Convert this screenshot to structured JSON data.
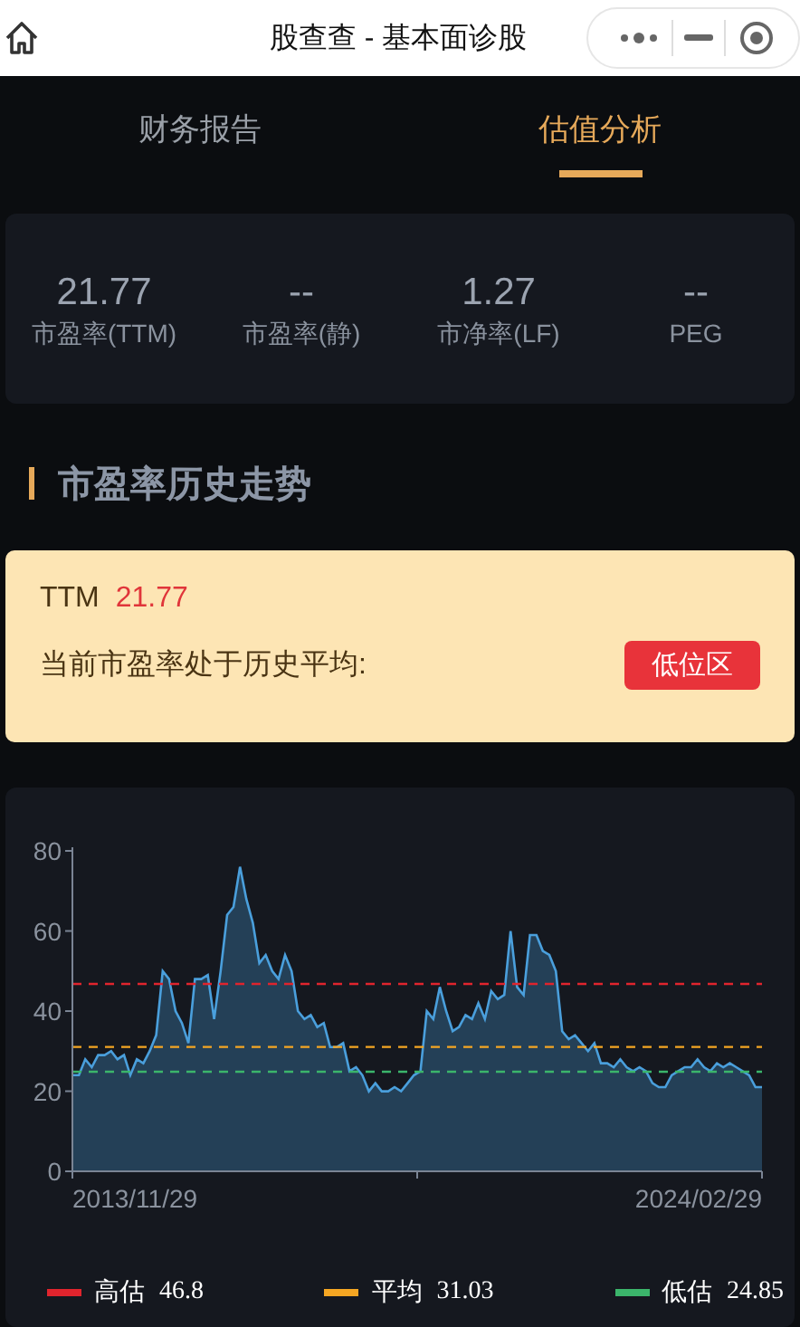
{
  "title_bar": {
    "title": "股查查 - 基本面诊股"
  },
  "tabs": [
    {
      "label": "财务报告",
      "selected": false
    },
    {
      "label": "估值分析",
      "selected": true
    }
  ],
  "metrics": [
    {
      "value": "21.77",
      "label": "市盈率(TTM)"
    },
    {
      "value": "--",
      "label": "市盈率(静)"
    },
    {
      "value": "1.27",
      "label": "市净率(LF)"
    },
    {
      "value": "--",
      "label": "PEG"
    }
  ],
  "section_title": "市盈率历史走势",
  "summary": {
    "label": "TTM",
    "value": "21.77",
    "text": "当前市盈率处于历史平均:",
    "badge": "低位区"
  },
  "chart": {
    "chart_data": {
      "type": "area",
      "ylim": [
        0,
        80
      ],
      "yticks": [
        0,
        20,
        40,
        60,
        80
      ],
      "legend": "bottom",
      "series": [
        {
          "color": "#4a9fdc",
          "values": [
            24,
            24,
            28,
            26,
            29,
            29,
            30,
            28,
            29,
            24,
            28,
            27,
            30,
            34,
            50,
            48,
            40,
            37,
            32,
            48,
            48,
            49,
            38,
            50,
            64,
            66,
            76,
            68,
            62,
            52,
            54,
            50,
            48,
            54,
            50,
            40,
            38,
            39,
            36,
            37,
            31,
            31,
            32,
            25,
            26,
            24,
            20,
            22,
            20,
            20,
            21,
            20,
            22,
            24,
            25,
            40,
            38,
            46,
            40,
            35,
            36,
            39,
            38,
            42,
            38,
            45,
            43,
            44,
            60,
            46,
            44,
            59,
            59,
            55,
            54,
            50,
            35,
            33,
            34,
            32,
            30,
            32,
            27,
            27,
            26,
            28,
            26,
            25,
            26,
            25,
            22,
            21,
            21,
            24,
            25,
            26,
            26,
            28,
            26,
            25,
            27,
            26,
            27,
            26,
            25,
            24,
            21,
            21
          ]
        },
        {
          "name": "高估",
          "type": "line",
          "line_style": "dashed",
          "color": "#e0242d",
          "values": [
            46.8,
            46.8,
            46.8,
            46.8,
            46.8,
            46.8,
            46.8,
            46.8,
            46.8,
            46.8,
            46.8,
            46.8,
            46.8,
            46.8,
            46.8,
            46.8,
            46.8,
            46.8,
            46.8,
            46.8,
            46.8,
            46.8,
            46.8,
            46.8,
            46.8,
            46.8,
            46.8,
            46.8,
            46.8,
            46.8,
            46.8,
            46.8,
            46.8,
            46.8,
            46.8,
            46.8,
            46.8,
            46.8,
            46.8,
            46.8,
            46.8,
            46.8,
            46.8,
            46.8,
            46.8,
            46.8,
            46.8,
            46.8,
            46.8,
            46.8,
            46.8,
            46.8,
            46.8,
            46.8,
            46.8,
            46.8,
            46.8,
            46.8,
            46.8,
            46.8,
            46.8,
            46.8,
            46.8,
            46.8,
            46.8,
            46.8,
            46.8,
            46.8,
            46.8,
            46.8,
            46.8,
            46.8,
            46.8,
            46.8,
            46.8,
            46.8,
            46.8,
            46.8,
            46.8,
            46.8,
            46.8,
            46.8,
            46.8,
            46.8,
            46.8,
            46.8,
            46.8,
            46.8,
            46.8,
            46.8,
            46.8,
            46.8,
            46.8,
            46.8,
            46.8,
            46.8,
            46.8,
            46.8,
            46.8,
            46.8,
            46.8,
            46.8,
            46.8,
            46.8,
            46.8,
            46.8,
            46.8,
            46.8
          ]
        },
        {
          "name": "平均",
          "type": "line",
          "line_style": "dashed",
          "color": "#f5a623",
          "values": [
            31.03,
            31.03,
            31.03,
            31.03,
            31.03,
            31.03,
            31.03,
            31.03,
            31.03,
            31.03,
            31.03,
            31.03,
            31.03,
            31.03,
            31.03,
            31.03,
            31.03,
            31.03,
            31.03,
            31.03,
            31.03,
            31.03,
            31.03,
            31.03,
            31.03,
            31.03,
            31.03,
            31.03,
            31.03,
            31.03,
            31.03,
            31.03,
            31.03,
            31.03,
            31.03,
            31.03,
            31.03,
            31.03,
            31.03,
            31.03,
            31.03,
            31.03,
            31.03,
            31.03,
            31.03,
            31.03,
            31.03,
            31.03,
            31.03,
            31.03,
            31.03,
            31.03,
            31.03,
            31.03,
            31.03,
            31.03,
            31.03,
            31.03,
            31.03,
            31.03,
            31.03,
            31.03,
            31.03,
            31.03,
            31.03,
            31.03,
            31.03,
            31.03,
            31.03,
            31.03,
            31.03,
            31.03,
            31.03,
            31.03,
            31.03,
            31.03,
            31.03,
            31.03,
            31.03,
            31.03,
            31.03,
            31.03,
            31.03,
            31.03,
            31.03,
            31.03,
            31.03,
            31.03,
            31.03,
            31.03,
            31.03,
            31.03,
            31.03,
            31.03,
            31.03,
            31.03,
            31.03,
            31.03,
            31.03,
            31.03,
            31.03,
            31.03,
            31.03,
            31.03,
            31.03,
            31.03,
            31.03,
            31.03
          ]
        },
        {
          "name": "低估",
          "type": "line",
          "line_style": "dashed",
          "color": "#3bb56b",
          "values": [
            24.85,
            24.85,
            24.85,
            24.85,
            24.85,
            24.85,
            24.85,
            24.85,
            24.85,
            24.85,
            24.85,
            24.85,
            24.85,
            24.85,
            24.85,
            24.85,
            24.85,
            24.85,
            24.85,
            24.85,
            24.85,
            24.85,
            24.85,
            24.85,
            24.85,
            24.85,
            24.85,
            24.85,
            24.85,
            24.85,
            24.85,
            24.85,
            24.85,
            24.85,
            24.85,
            24.85,
            24.85,
            24.85,
            24.85,
            24.85,
            24.85,
            24.85,
            24.85,
            24.85,
            24.85,
            24.85,
            24.85,
            24.85,
            24.85,
            24.85,
            24.85,
            24.85,
            24.85,
            24.85,
            24.85,
            24.85,
            24.85,
            24.85,
            24.85,
            24.85,
            24.85,
            24.85,
            24.85,
            24.85,
            24.85,
            24.85,
            24.85,
            24.85,
            24.85,
            24.85,
            24.85,
            24.85,
            24.85,
            24.85,
            24.85,
            24.85,
            24.85,
            24.85,
            24.85,
            24.85,
            24.85,
            24.85,
            24.85,
            24.85,
            24.85,
            24.85,
            24.85,
            24.85,
            24.85,
            24.85,
            24.85,
            24.85,
            24.85,
            24.85,
            24.85,
            24.85,
            24.85,
            24.85,
            24.85,
            24.85,
            24.85,
            24.85,
            24.85,
            24.85,
            24.85,
            24.85,
            24.85,
            24.85
          ]
        }
      ]
    },
    "legend_values": [
      "46.8",
      "31.03",
      "24.85"
    ],
    "x_labels": [
      "2013/11/29",
      "2024/02/29"
    ]
  }
}
